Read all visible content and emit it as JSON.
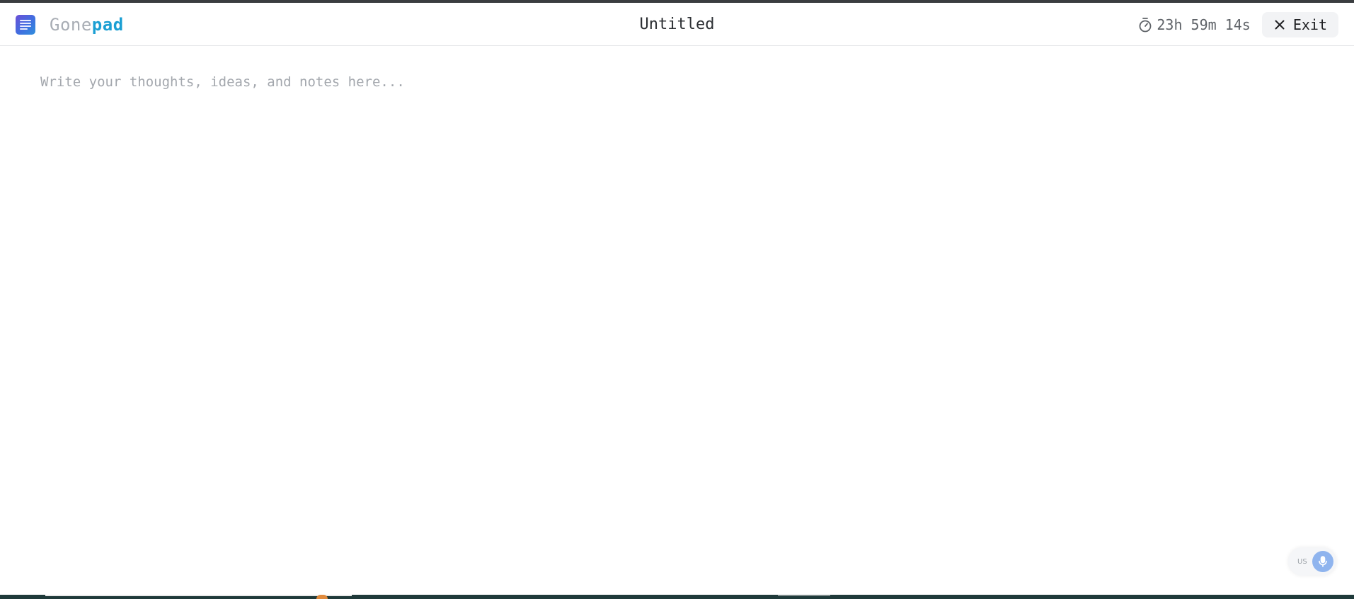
{
  "brand": {
    "name_part1": "Gone",
    "name_part2": "pad",
    "icon": "notepad-logo-icon",
    "accent_color": "#1b9fd3"
  },
  "document": {
    "title": "Untitled"
  },
  "timer": {
    "icon": "stopwatch-icon",
    "remaining": "23h 59m 14s"
  },
  "exit_button": {
    "icon": "close-icon",
    "label": "Exit"
  },
  "editor": {
    "value": "",
    "placeholder": "Write your thoughts, ideas, and notes here..."
  },
  "voice": {
    "language": "US",
    "icon": "microphone-icon"
  }
}
